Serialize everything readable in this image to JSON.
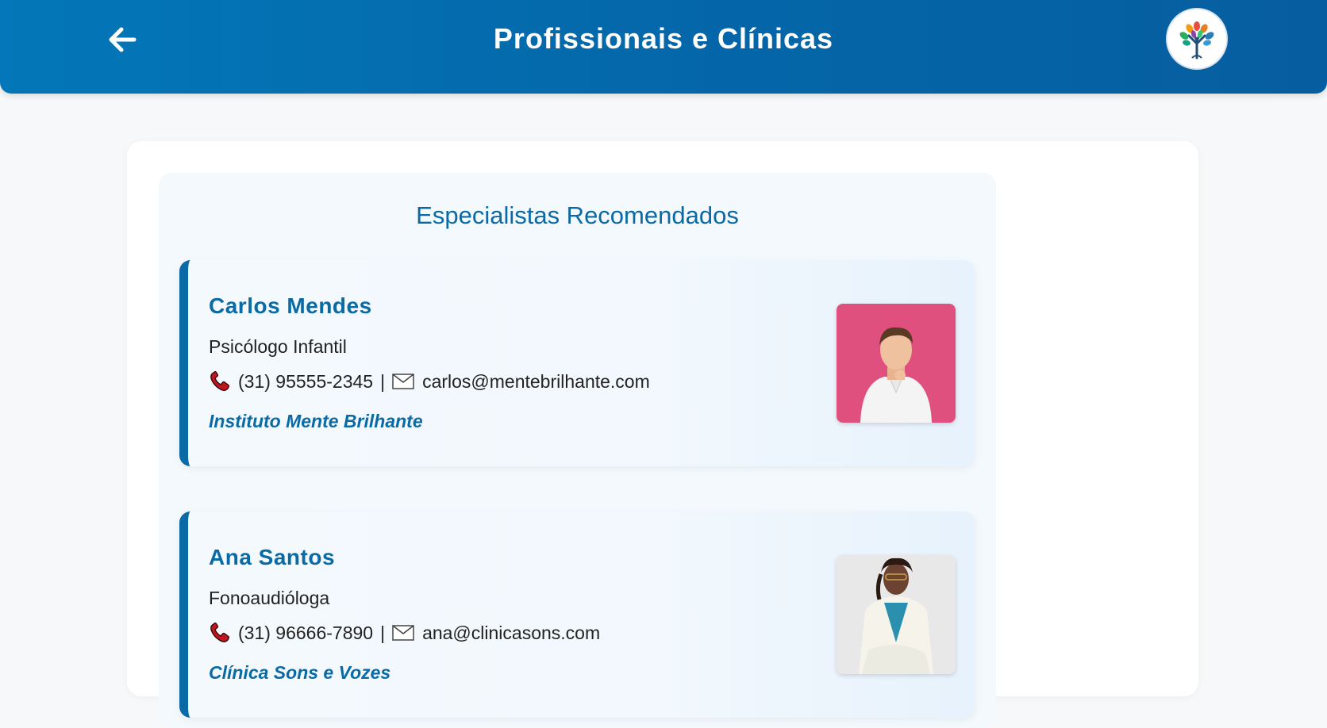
{
  "header": {
    "title": "Profissionais e Clínicas",
    "back_icon": "arrow-left-icon",
    "logo_icon": "colorful-tree-logo"
  },
  "section": {
    "title": "Especialistas Recomendados"
  },
  "professionals": [
    {
      "name": "Carlos Mendes",
      "role": "Psicólogo Infantil",
      "phone": "(31) 95555-2345",
      "separator": "|",
      "email": "carlos@mentebrilhante.com",
      "clinic": "Instituto Mente Brilhante",
      "photo_bg": "#e0507e"
    },
    {
      "name": "Ana Santos",
      "role": "Fonoaudióloga",
      "phone": "(31) 96666-7890",
      "separator": "|",
      "email": "ana@clinicasons.com",
      "clinic": "Clínica Sons e Vozes",
      "photo_bg": "#e8e8e8"
    }
  ],
  "colors": {
    "header": "#0466a8",
    "accent": "#0a6aa5"
  }
}
